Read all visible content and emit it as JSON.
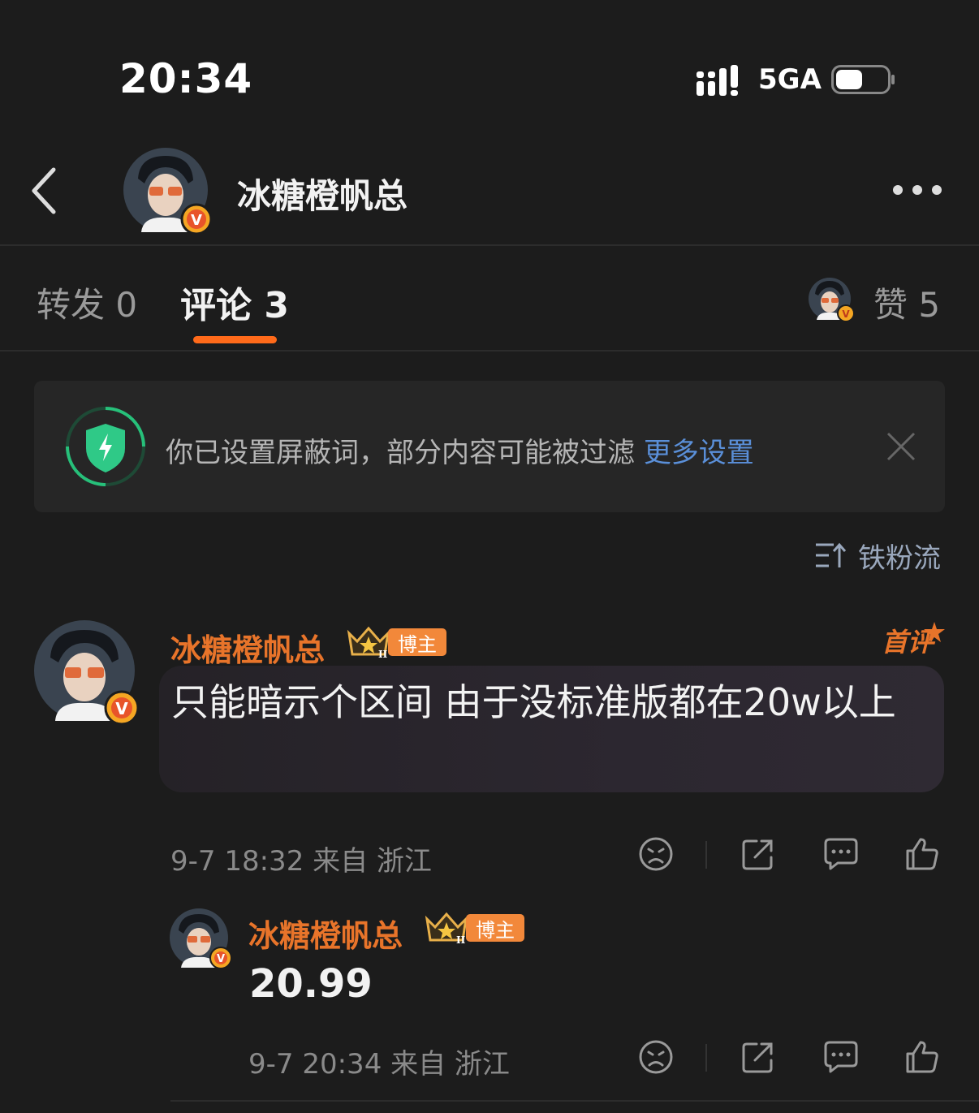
{
  "status_bar": {
    "time": "20:34",
    "network": "5GA"
  },
  "header": {
    "title": "冰糖橙帆总"
  },
  "tabs": {
    "repost_label": "转发",
    "repost_count": "0",
    "comment_label": "评论",
    "comment_count": "3",
    "like_label": "赞",
    "like_count": "5"
  },
  "notice": {
    "text": "你已设置屏蔽词，部分内容可能被过滤",
    "link": "更多设置"
  },
  "sort": {
    "label": "铁粉流"
  },
  "comments": [
    {
      "author": "冰糖橙帆总",
      "badge": "博主",
      "first_tag": "首评",
      "text": "只能暗示个区间 由于没标准版都在20w以上",
      "meta": "9-7 18:32  来自 浙江"
    },
    {
      "author": "冰糖橙帆总",
      "badge": "博主",
      "text": "20.99",
      "meta": "9-7 20:34  来自 浙江"
    }
  ],
  "colors": {
    "accent": "#ff6a1a",
    "author_name": "#e8742a",
    "link": "#5a8fd8",
    "background": "#1c1c1c"
  },
  "icons": [
    "back-icon",
    "more-icon",
    "shield-icon",
    "close-icon",
    "sort-icon",
    "crown-icon",
    "sad-face-icon",
    "share-icon",
    "reply-icon",
    "like-icon"
  ]
}
